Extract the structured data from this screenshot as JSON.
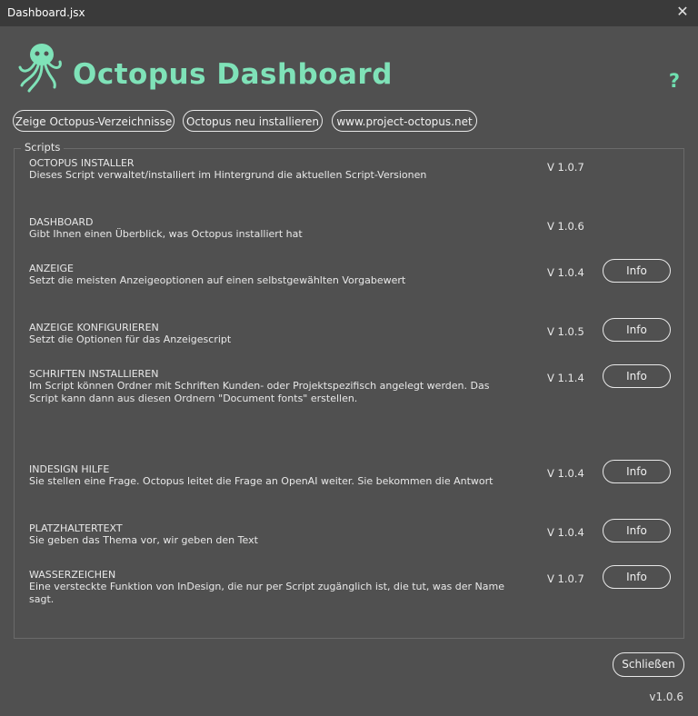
{
  "window": {
    "title": "Dashboard.jsx",
    "close_glyph": "✕"
  },
  "header": {
    "app_title": "Octopus Dashboard",
    "help_label": "?"
  },
  "buttons": {
    "show_dirs": "Zeige Octopus-Verzeichnisse",
    "reinstall": "Octopus neu installieren",
    "website": "www.project-octopus.net"
  },
  "scripts": {
    "label": "Scripts",
    "items": [
      {
        "name": "OCTOPUS INSTALLER",
        "desc": "Dieses Script verwaltet/installiert im Hintergrund die aktuellen Script-Versionen",
        "version": "V 1.0.7"
      },
      {
        "name": "DASHBOARD",
        "desc": "Gibt Ihnen einen Überblick, was Octopus installiert hat",
        "version": "V 1.0.6"
      },
      {
        "name": "ANZEIGE",
        "desc": "Setzt die meisten Anzeigeoptionen auf einen selbstgewählten Vorgabewert",
        "version": "V 1.0.4",
        "info": "Info"
      },
      {
        "name": "ANZEIGE KONFIGURIEREN",
        "desc": "Setzt die Optionen für das Anzeigescript",
        "version": "V 1.0.5",
        "info": "Info"
      },
      {
        "name": "SCHRIFTEN INSTALLIEREN",
        "desc": "Im Script können Ordner mit Schriften Kunden- oder Projektspezifisch angelegt werden. Das Script kann dann aus diesen Ordnern \"Document fonts\" erstellen.",
        "version": "V 1.1.4",
        "info": "Info"
      },
      {
        "name": "INDESIGN HILFE",
        "desc": "Sie stellen eine Frage. Octopus leitet die Frage an OpenAI weiter. Sie bekommen die Antwort",
        "version": "V 1.0.4",
        "info": "Info"
      },
      {
        "name": "PLATZHALTERTEXT",
        "desc": "Sie geben das Thema vor, wir geben den Text",
        "version": "V 1.0.4",
        "info": "Info"
      },
      {
        "name": "WASSERZEICHEN",
        "desc": "Eine versteckte Funktion von InDesign, die nur per Script zugänglich ist, die tut, was der Name sagt.",
        "version": "V 1.0.7",
        "info": "Info"
      }
    ]
  },
  "footer": {
    "close_label": "Schließen",
    "version": "v1.0.6"
  },
  "colors": {
    "accent": "#7fe2b8",
    "background": "#505050",
    "titlebar": "#3a3a3a"
  },
  "icons": {
    "logo": "octopus-logo-icon",
    "close": "close-icon"
  }
}
